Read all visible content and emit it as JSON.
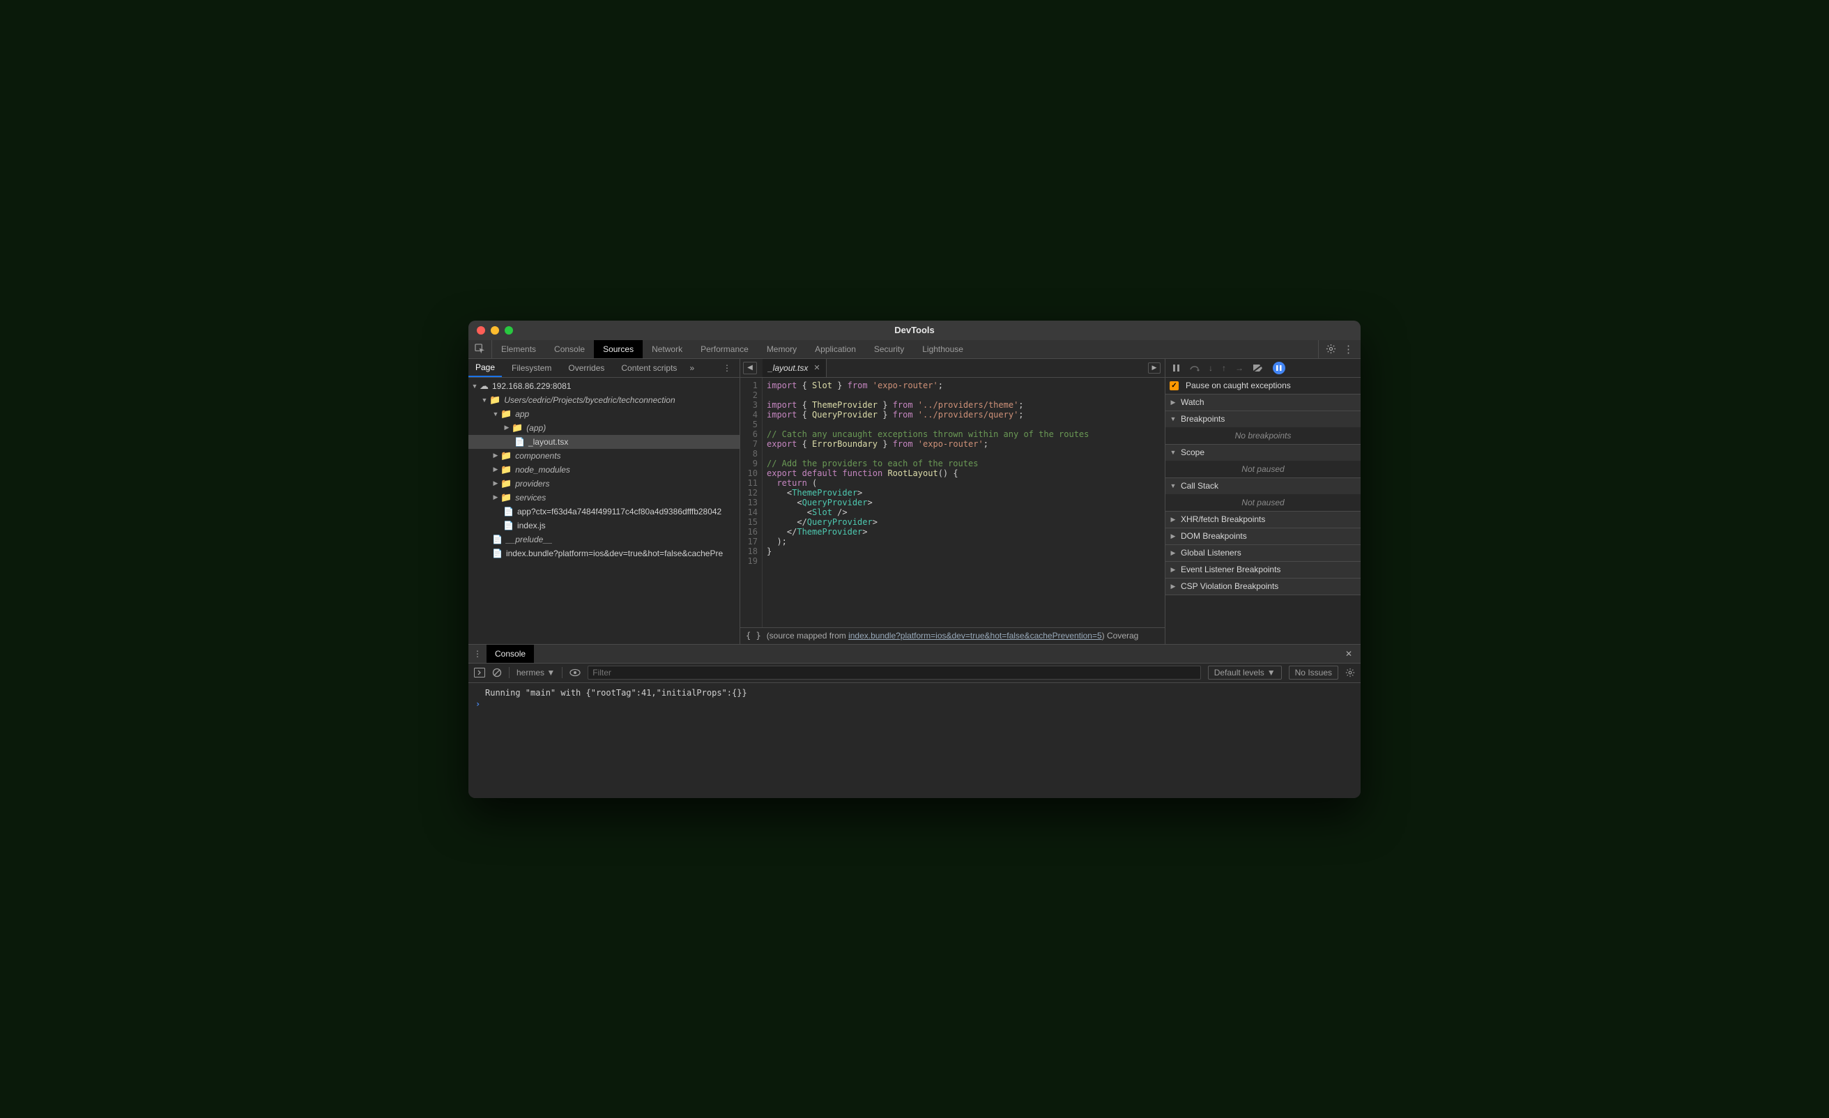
{
  "window": {
    "title": "DevTools"
  },
  "mainTabs": [
    "Elements",
    "Console",
    "Sources",
    "Network",
    "Performance",
    "Memory",
    "Application",
    "Security",
    "Lighthouse"
  ],
  "mainTabActive": "Sources",
  "navTabs": [
    "Page",
    "Filesystem",
    "Overrides",
    "Content scripts"
  ],
  "navTabActive": "Page",
  "tree": {
    "origin": "192.168.86.229:8081",
    "projectPath": "Users/cedric/Projects/bycedric/techconnection",
    "appFolder": "app",
    "appInner": "(app)",
    "layoutFile": "_layout.tsx",
    "components": "components",
    "node_modules": "node_modules",
    "providers": "providers",
    "services": "services",
    "ctxFile": "app?ctx=f63d4a7484f499117c4cf80a4d9386dfffb28042",
    "indexFile": "index.js",
    "prelude": "__prelude__",
    "bundle": "index.bundle?platform=ios&dev=true&hot=false&cachePre"
  },
  "editor": {
    "fileTab": "_layout.tsx",
    "lineCount": 19,
    "code": {
      "l1": {
        "a": "import",
        "b": " { ",
        "c": "Slot",
        "d": " } ",
        "e": "from",
        "f": " ",
        "g": "'expo-router'",
        "h": ";"
      },
      "l3": {
        "a": "import",
        "b": " { ",
        "c": "ThemeProvider",
        "d": " } ",
        "e": "from",
        "f": " ",
        "g": "'../providers/theme'",
        "h": ";"
      },
      "l4": {
        "a": "import",
        "b": " { ",
        "c": "QueryProvider",
        "d": " } ",
        "e": "from",
        "f": " ",
        "g": "'../providers/query'",
        "h": ";"
      },
      "l6": "// Catch any uncaught exceptions thrown within any of the routes",
      "l7": {
        "a": "export",
        "b": " { ",
        "c": "ErrorBoundary",
        "d": " } ",
        "e": "from",
        "f": " ",
        "g": "'expo-router'",
        "h": ";"
      },
      "l9": "// Add the providers to each of the routes",
      "l10": {
        "a": "export",
        "b": " ",
        "c": "default",
        "d": " ",
        "e": "function",
        "f": " ",
        "g": "RootLayout",
        "h": "() {"
      },
      "l11": {
        "a": "  ",
        "b": "return",
        "c": " ("
      },
      "l12": {
        "a": "    <",
        "b": "ThemeProvider",
        "c": ">"
      },
      "l13": {
        "a": "      <",
        "b": "QueryProvider",
        "c": ">"
      },
      "l14": {
        "a": "        <",
        "b": "Slot",
        "c": " />"
      },
      "l15": {
        "a": "      </",
        "b": "QueryProvider",
        "c": ">"
      },
      "l16": {
        "a": "    </",
        "b": "ThemeProvider",
        "c": ">"
      },
      "l17": "  );",
      "l18": "}"
    },
    "statusPrefix": "(source mapped from ",
    "statusLink": "index.bundle?platform=ios&dev=true&hot=false&cachePrevention=5",
    "statusSuffix": ")  Coverag"
  },
  "debugger": {
    "pauseOnCaught": "Pause on caught exceptions",
    "watch": "Watch",
    "breakpoints": "Breakpoints",
    "noBreakpoints": "No breakpoints",
    "scope": "Scope",
    "notPaused": "Not paused",
    "callStack": "Call Stack",
    "xhr": "XHR/fetch Breakpoints",
    "dom": "DOM Breakpoints",
    "globalListeners": "Global Listeners",
    "eventListener": "Event Listener Breakpoints",
    "csp": "CSP Violation Breakpoints"
  },
  "drawer": {
    "tab": "Console",
    "context": "hermes",
    "filterPlaceholder": "Filter",
    "levels": "Default levels",
    "issues": "No Issues",
    "logLine": "Running \"main\" with {\"rootTag\":41,\"initialProps\":{}}"
  }
}
